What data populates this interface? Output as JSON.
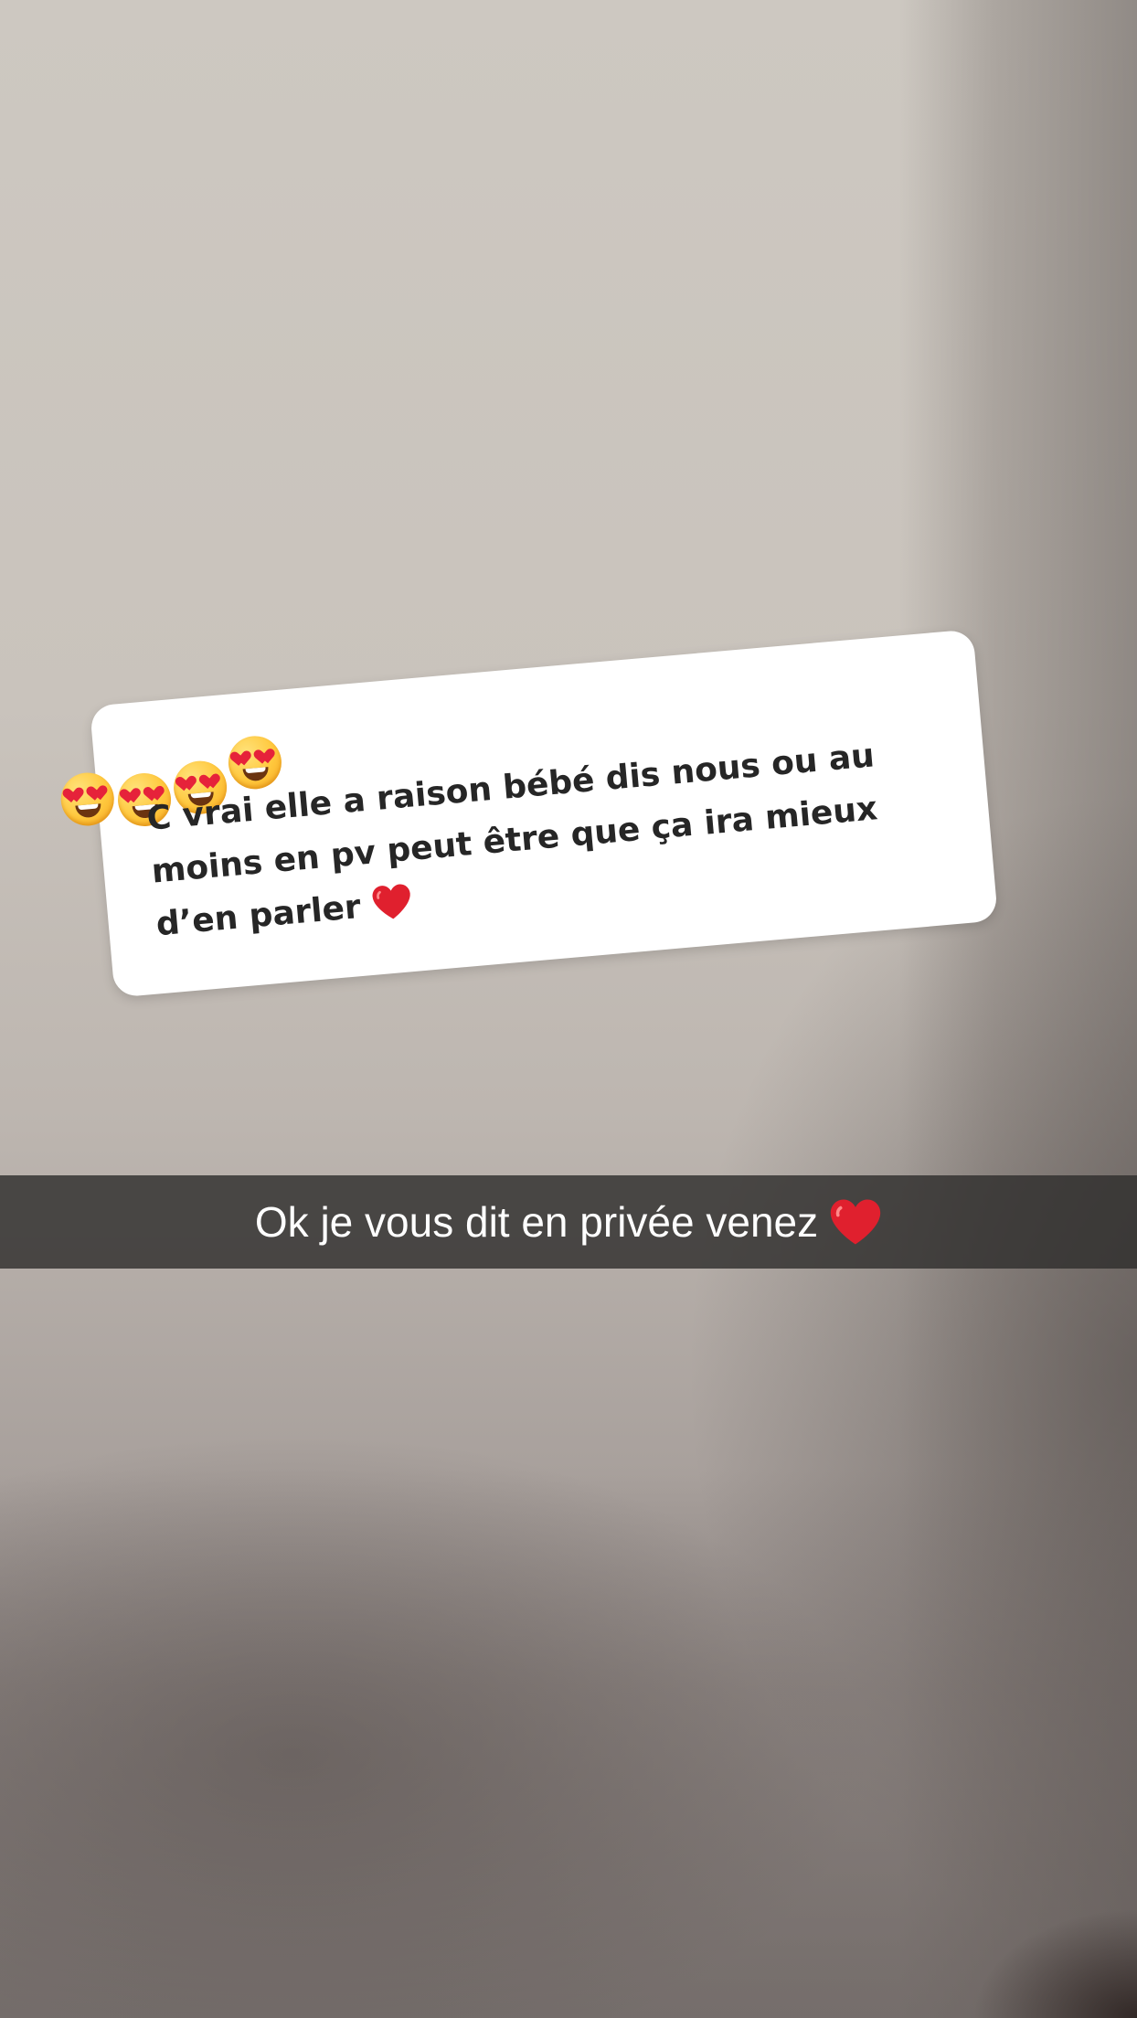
{
  "sticker": {
    "text": "C vrai elle a raison bébé dis nous ou au moins en pv peut être que ça ira mieux d’en parler",
    "heart_icon": "red-heart",
    "emoji_icons": [
      "heart-eyes-emoji",
      "heart-eyes-emoji",
      "heart-eyes-emoji",
      "heart-eyes-emoji"
    ]
  },
  "caption": {
    "text": "Ok je vous dit en privée venez",
    "heart_icon": "red-heart"
  },
  "colors": {
    "heart": "#e0202e",
    "caption_bar": "#302e2d",
    "sticker_text": "#262626"
  }
}
